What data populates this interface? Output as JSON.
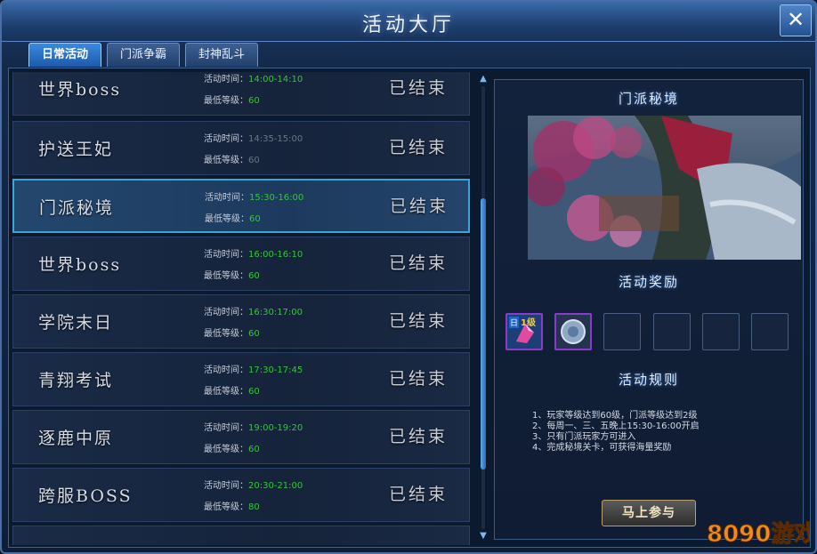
{
  "window": {
    "title": "活动大厅",
    "close_label": "✕"
  },
  "tabs": [
    {
      "label": "日常活动",
      "active": true
    },
    {
      "label": "门派争霸",
      "active": false
    },
    {
      "label": "封神乱斗",
      "active": false
    }
  ],
  "activities": [
    {
      "name": "世界boss",
      "time_label": "活动时间：",
      "time": "14:00-14:10",
      "level_label": "最低等级：",
      "level": "60",
      "status": "已结束",
      "dim": false
    },
    {
      "name": "护送王妃",
      "time_label": "活动时间：",
      "time": "14:35-15:00",
      "level_label": "最低等级：",
      "level": "60",
      "status": "已结束",
      "dim": true
    },
    {
      "name": "门派秘境",
      "time_label": "活动时间：",
      "time": "15:30-16:00",
      "level_label": "最低等级：",
      "level": "60",
      "status": "已结束",
      "dim": false,
      "selected": true
    },
    {
      "name": "世界boss",
      "time_label": "活动时间：",
      "time": "16:00-16:10",
      "level_label": "最低等级：",
      "level": "60",
      "status": "已结束",
      "dim": false
    },
    {
      "name": "学院末日",
      "time_label": "活动时间：",
      "time": "16:30:17:00",
      "level_label": "最低等级：",
      "level": "60",
      "status": "已结束",
      "dim": false
    },
    {
      "name": "青翔考试",
      "time_label": "活动时间：",
      "time": "17:30-17:45",
      "level_label": "最低等级：",
      "level": "60",
      "status": "已结束",
      "dim": false
    },
    {
      "name": "逐鹿中原",
      "time_label": "活动时间：",
      "time": "19:00-19:20",
      "level_label": "最低等级：",
      "level": "60",
      "status": "已结束",
      "dim": false
    },
    {
      "name": "跨服BOSS",
      "time_label": "活动时间：",
      "time": "20:30-21:00",
      "level_label": "最低等级：",
      "level": "80",
      "status": "已结束",
      "dim": false
    }
  ],
  "detail": {
    "title": "门派秘境",
    "reward_title": "活动奖励",
    "reward_badge": "1级",
    "reward_tag": "日",
    "rules_title": "活动规则",
    "rules": [
      "1、玩家等级达到60级，门派等级达到2级",
      "2、每周一、三、五晚上15:30-16:00开启",
      "3、只有门派玩家方可进入",
      "4、完成秘境关卡，可获得海量奖励"
    ],
    "join_label": "马上参与"
  },
  "watermark": {
    "text": "8090游戏"
  },
  "colors": {
    "accent": "#3ea3d8",
    "value_green": "#39c23c",
    "reward_border": "#8a3cc8"
  }
}
